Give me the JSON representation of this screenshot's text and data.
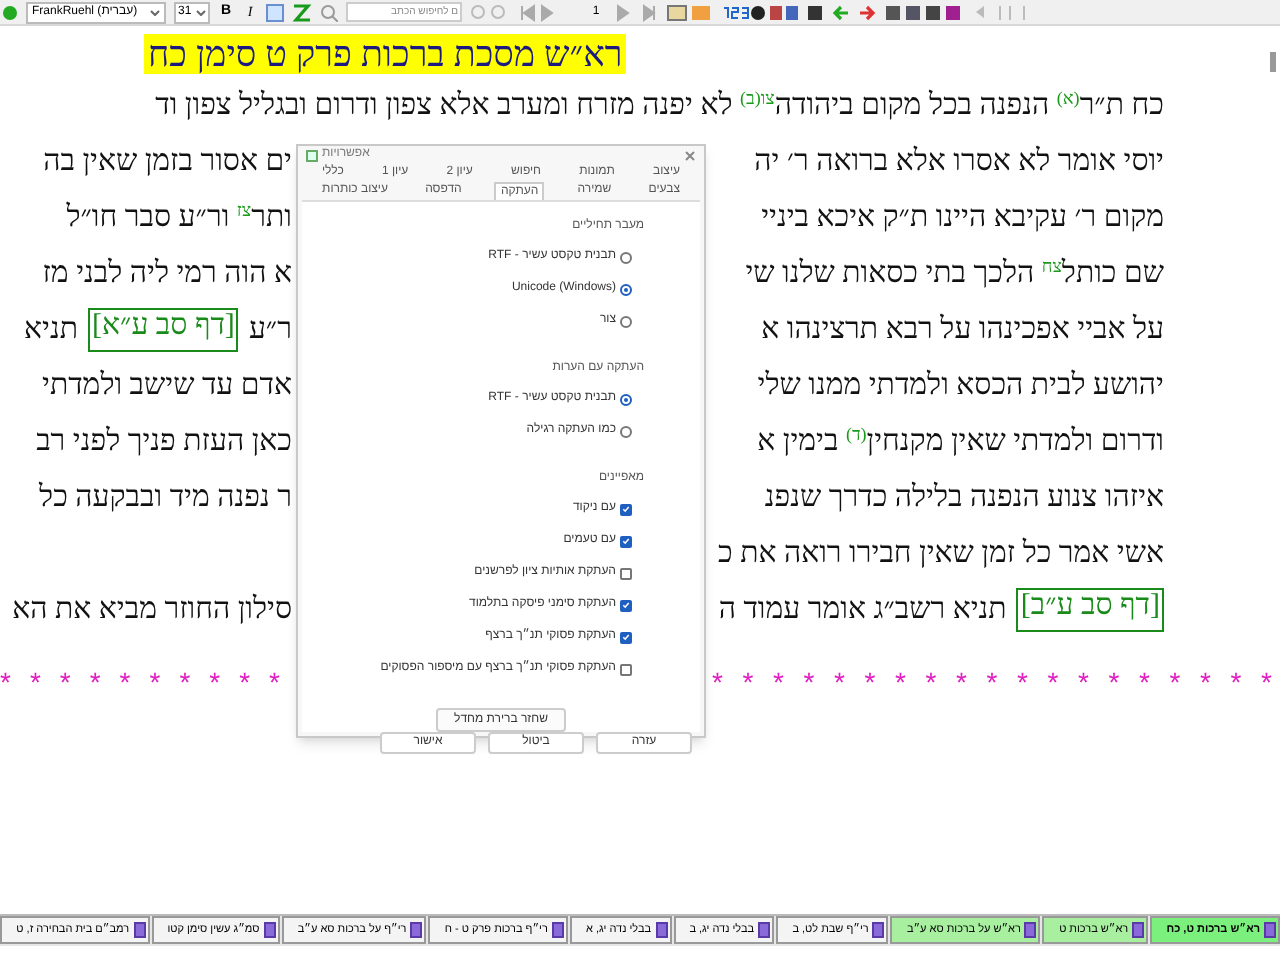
{
  "toolbar": {
    "font_name": "FrankRuehl (עברית)",
    "font_size": "31",
    "bold": "B",
    "italic": "I",
    "search": {
      "value": "ם לחיפוש הכתב"
    },
    "page": "1"
  },
  "heading": "רא״ש מסכת ברכות פרק ט סימן כח",
  "lines": [
    {
      "kind": "full",
      "right": [
        {
          "kind": "text",
          "text": "כח ת״ר$^{(א)}$ הנפנה בכל מקום ביהודה$^{צו(ב)}$ לא יפנה מזרח ומערב אלא צפון ודרום ובגליל צפון וד"
        }
      ]
    },
    {
      "kind": "split",
      "right": [
        {
          "kind": "text",
          "text": "יוסי אומר לא אסרו אלא ברואה ר׳ יה"
        }
      ],
      "left": [
        {
          "kind": "text",
          "text": "ים אסור בזמן שאין בה"
        }
      ]
    },
    {
      "kind": "split",
      "right": [
        {
          "kind": "text",
          "text": "מקום ר׳ עקיבא היינו ת״ק איכא ביניי"
        }
      ],
      "left": [
        {
          "kind": "text",
          "text": "ותר$^{צז}$ ור״ע סבר חו״ל"
        }
      ]
    },
    {
      "kind": "split",
      "right": [
        {
          "kind": "text",
          "text": "שם כותל$^{צח}$ הלכך בתי כסאות שלנו שי"
        }
      ],
      "left": [
        {
          "kind": "text",
          "text": "א הוה רמי ליה לבני מז"
        }
      ]
    },
    {
      "kind": "split",
      "right": [
        {
          "kind": "text",
          "text": "על אביי אפכינהו על רבא תרצינהו א"
        }
      ],
      "left": [
        {
          "kind": "text",
          "text": "ר״ע"
        },
        {
          "kind": "link",
          "text": "[דף סב ע״א]"
        },
        {
          "kind": "text",
          "text": "תניא"
        }
      ]
    },
    {
      "kind": "split",
      "right": [
        {
          "kind": "text",
          "text": "יהושע לבית הכסא ולמדתי ממנו שלי"
        }
      ],
      "left": [
        {
          "kind": "text",
          "text": "אדם עד שישב ולמדתי"
        }
      ]
    },
    {
      "kind": "split",
      "right": [
        {
          "kind": "text",
          "text": "ודרום ולמדתי שאין מקנחין$^{(ד)}$ בימין א"
        }
      ],
      "left": [
        {
          "kind": "text",
          "text": "כאן העזת פניך לפני רב"
        }
      ]
    },
    {
      "kind": "split",
      "right": [
        {
          "kind": "text",
          "text": "איזהו צנוע הנפנה בלילה כדרך שנפנ"
        }
      ],
      "left": [
        {
          "kind": "text",
          "text": "ר נפנה מיד ובבקעה כל"
        }
      ]
    },
    {
      "kind": "split",
      "right": [
        {
          "kind": "text",
          "text": "אשי אמר כל זמן שאין חבירו רואה את כ"
        }
      ]
    },
    {
      "kind": "split",
      "right": [
        {
          "kind": "link",
          "text": "[דף סב ע״ב]"
        },
        {
          "kind": "text",
          "text": "תניא רשב״ג אומר עמוד ה"
        }
      ],
      "left": [
        {
          "kind": "text",
          "text": "סילון החוזר מביא את הא"
        }
      ]
    }
  ],
  "separator": [
    "* * * * * * * * * * * * * * * * * * *",
    "* * * * * * * * * *"
  ],
  "dialog": {
    "title": "אפשרויות",
    "tab_rows": [
      [
        {
          "label": "עיצוב",
          "selected": false
        },
        {
          "label": "תמונות",
          "selected": false
        },
        {
          "label": "חיפוש",
          "selected": false
        },
        {
          "label": "עיון 2",
          "selected": false
        },
        {
          "label": "עיון 1",
          "selected": false
        },
        {
          "label": "כללי",
          "selected": false
        }
      ],
      [
        {
          "label": "צבעים",
          "selected": false
        },
        {
          "label": "שמירה",
          "selected": false
        },
        {
          "label": "העתקה",
          "selected": true
        },
        {
          "label": "הדפסה",
          "selected": false
        },
        {
          "label": "עיצוב כותרות",
          "selected": false
        }
      ]
    ],
    "sections": [
      {
        "title": "מעבר תחיליים",
        "kind": "radio",
        "options": [
          {
            "label": "תבנית טקסט עשיר - RTF",
            "checked": false
          },
          {
            "label": "Unicode (Windows)",
            "checked": true
          },
          {
            "label": "צור",
            "checked": false
          }
        ]
      },
      {
        "title": "העתקה עם הערות",
        "kind": "radio",
        "options": [
          {
            "label": "תבנית טקסט עשיר - RTF",
            "checked": true
          },
          {
            "label": "כמו העתקה רגילה",
            "checked": false
          }
        ]
      },
      {
        "title": "מאפיינים",
        "kind": "checkbox",
        "options": [
          {
            "label": "עם ניקוד",
            "checked": true
          },
          {
            "label": "עם טעמים",
            "checked": true
          },
          {
            "label": "העתקת אותיות ציון לפרשנים",
            "checked": false
          },
          {
            "label": "העתקת סימני פיסקה בתלמוד",
            "checked": true
          },
          {
            "label": "העתקת פסוקי תנ״ך ברצף",
            "checked": true
          },
          {
            "label": "העתקת פסוקי תנ״ך ברצף עם מיספור הפסוקים",
            "checked": false
          }
        ]
      }
    ],
    "restore_button": "שחזר ברירת מחדל",
    "buttons": [
      "עזרה",
      "ביטול",
      "אישור"
    ]
  },
  "tabs": [
    {
      "label": "רא״ש ברכות ט, כח",
      "selected": true,
      "color": "#7cf07c"
    },
    {
      "label": "רא״ש ברכות ט",
      "selected": false,
      "color": "#a8f0a0"
    },
    {
      "label": "רא״ש על ברכות סא ע״ב",
      "selected": false,
      "color": "#a8f0a0"
    },
    {
      "label": "רי״ף שבת לט, ב",
      "selected": false,
      "color": "#f4f4f4"
    },
    {
      "label": "בבלי נדה יג, ב",
      "selected": false,
      "color": "#f4f4f4"
    },
    {
      "label": "בבלי נדה יג, א",
      "selected": false,
      "color": "#f4f4f4"
    },
    {
      "label": "רי״ף ברכות פרק ט - ח",
      "selected": false,
      "color": "#f4f4f4"
    },
    {
      "label": "רי״ף על ברכות סא ע״ב",
      "selected": false,
      "color": "#f4f4f4"
    },
    {
      "label": "סמ״ג עשין סימן קטו",
      "selected": false,
      "color": "#f4f4f4"
    },
    {
      "label": "רמב״ם בית הבחירה ז, ט",
      "selected": false,
      "color": "#f4f4f4"
    }
  ]
}
